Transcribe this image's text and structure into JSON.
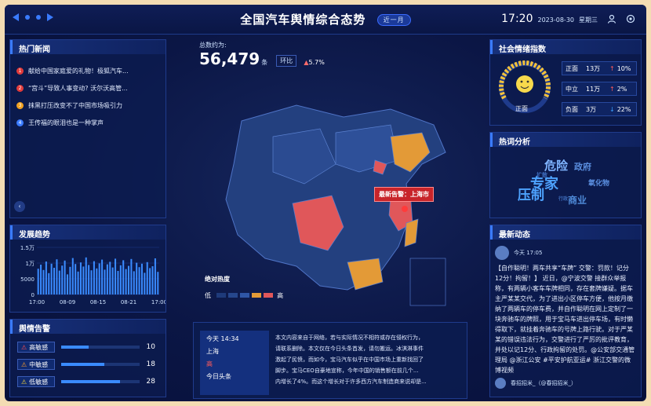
{
  "header": {
    "title": "全国汽车舆情综合态势",
    "range_pill": "近一月",
    "time": "17:20",
    "date": "2023-08-30",
    "weekday": "星期三"
  },
  "hot_news": {
    "title": "热门新闻",
    "items": [
      {
        "rank": "1",
        "text": "献给中国家庭爱的礼物！极狐汽车..."
      },
      {
        "rank": "2",
        "text": "“宫斗”导致人事变动? 沃尔沃高管..."
      },
      {
        "rank": "3",
        "text": "抹黑打压改变不了中国市场吸引力"
      },
      {
        "rank": "4",
        "text": "王传福的眼泪也是一种掌声"
      }
    ]
  },
  "trend": {
    "title": "发展趋势",
    "y_ticks": [
      "1.5万",
      "1万",
      "5000",
      "0"
    ],
    "x_ticks": [
      "17:00",
      "08-09",
      "08-15",
      "08-21",
      "17:00"
    ]
  },
  "chart_data": {
    "type": "bar",
    "ylim": [
      0,
      15000
    ],
    "values": [
      8200,
      9500,
      7800,
      10500,
      6800,
      9800,
      8500,
      11200,
      7600,
      9200,
      10800,
      6400,
      8800,
      11600,
      9700,
      7300,
      10200,
      8900,
      11800,
      9400,
      7700,
      10600,
      8300,
      9900,
      11100,
      7900,
      9600,
      10400,
      8600,
      11400,
      7500,
      9300,
      10900,
      8100,
      9100,
      11300,
      7400,
      10100,
      8700,
      9800,
      6900,
      10300,
      8400,
      9000,
      11500,
      7200
    ]
  },
  "total": {
    "label": "总数约为:",
    "value": "56,479",
    "unit": "条",
    "huanbi_label": "环比",
    "huanbi_value": "5.7%"
  },
  "map": {
    "callout": "最新告警：上海市",
    "legend_title": "绝对热度",
    "legend_low": "低",
    "legend_high": "高"
  },
  "alerts": {
    "title": "舆情告警",
    "rows": [
      {
        "label": "高敏感",
        "value": "10",
        "color": "#ff4d4f",
        "fill": 0.35
      },
      {
        "label": "中敏感",
        "value": "18",
        "color": "#ff9f2a",
        "fill": 0.55
      },
      {
        "label": "低敏感",
        "value": "28",
        "color": "#f5d53a",
        "fill": 0.75
      }
    ]
  },
  "latest_event": {
    "time": "今天 14:34",
    "city": "上海",
    "level": "高",
    "source": "今日头条",
    "lines": [
      "本文内容来自于网络，若与实际情况不相符或存在侵权行为，",
      "请联系删除。本文仅在今日头条首发，请勿搬运。冰淇淋事件",
      "激起了民愤，而如今，宝马汽车似乎在中国市场上重新找回了",
      "脚步。宝马CEO自豪地宣称，今年中国的销售额在前几个...",
      "内增长了4%。而这个增长对于许多西方汽车制造商来说却是..."
    ]
  },
  "sentiment": {
    "title": "社会情绪指数",
    "center_label": "正面",
    "rows": [
      {
        "label": "正面",
        "count": "13万",
        "change": "10%",
        "dir": "up",
        "color": "#ff5a5a"
      },
      {
        "label": "中立",
        "count": "11万",
        "change": "2%",
        "dir": "up",
        "color": "#ff5a5a"
      },
      {
        "label": "负面",
        "count": "3万",
        "change": "22%",
        "dir": "down",
        "color": "#3aa0ff"
      }
    ]
  },
  "hotwords": {
    "title": "热词分析",
    "words": [
      "危险",
      "政府",
      "扩散",
      "专家",
      "压制",
      "氧化物",
      "行政",
      "商业",
      "警告"
    ]
  },
  "dynamics": {
    "title": "最新动态",
    "post_time": "今天 17:05",
    "text": "【自作聪明！两车共享“车牌” 交警：罚款！记分12分！拘留！】 近日，@宁波交警 接群众举报称，有两辆小客车车牌相同，存在套牌嫌疑。据车主严某某交代，为了进出小区停车方便，他按月缴纳了两辆车的停车费，并自作聪明在网上定制了一块奔驰车的牌照，用于宝马车进出停车场，有时懒得取下，就挂着奔驰车的号牌上路行驶。对于严某某的错误违法行为，交警进行了严厉的批评教育，并处以记12分、行政拘留的处罚。@公安部交通管理局 @浙江公安 #平安护航亚运# 浙江交警的微博视频",
    "footer_user": "春招招米_（@春招招米_）"
  }
}
